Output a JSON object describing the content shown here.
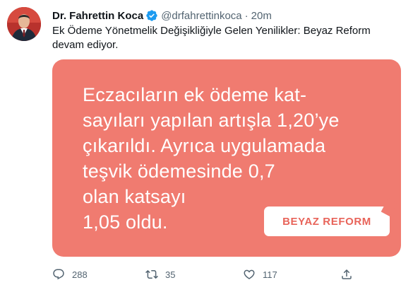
{
  "tweet": {
    "author_name": "Dr. Fahrettin Koca",
    "handle": "@drfahrettinkoca",
    "separator": "·",
    "time": "20m",
    "text": "Ek Ödeme Yönetmelik Değişikliğiyle Gelen Yenilikler: Beyaz Reform devam ediyor.",
    "verified": true
  },
  "media": {
    "lines": [
      "Eczacıların ek ödeme kat-",
      "sayıları yapılan artışla 1,20’ye",
      "çıkarıldı. Ayrıca uygulamada",
      "teşvik ödemesinde 0,7",
      "olan katsayı",
      "1,05 oldu."
    ],
    "badge": "BEYAZ REFORM",
    "background_color": "#f07b70",
    "badge_text_color": "#e8645a"
  },
  "actions": {
    "reply": {
      "icon": "reply-icon",
      "count": "288"
    },
    "retweet": {
      "icon": "retweet-icon",
      "count": "35"
    },
    "like": {
      "icon": "heart-icon",
      "count": "117"
    },
    "share": {
      "icon": "share-icon",
      "count": ""
    }
  },
  "colors": {
    "text_primary": "#0f1419",
    "text_secondary": "#536471",
    "verified_blue": "#1d9bf0"
  }
}
